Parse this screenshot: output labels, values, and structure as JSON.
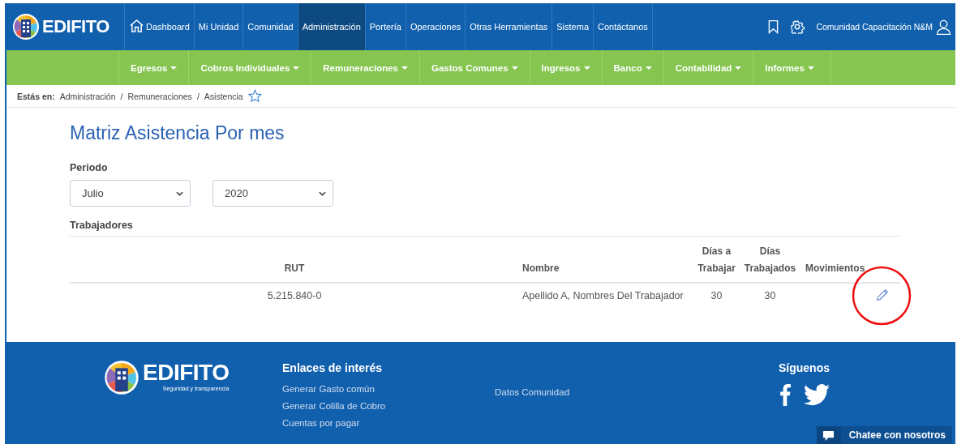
{
  "topnav": {
    "logo": "EDIFITO",
    "items": [
      {
        "label": "Dashboard",
        "kind": "with_icon",
        "selected": false
      },
      {
        "label": "Mi Unidad",
        "kind": "plain",
        "selected": false
      },
      {
        "label": "Comunidad",
        "kind": "plain",
        "selected": false
      },
      {
        "label": "Administración",
        "kind": "plain",
        "selected": true
      },
      {
        "label": "Portería",
        "kind": "plain",
        "selected": false
      },
      {
        "label": "Operaciones",
        "kind": "plain",
        "selected": false
      },
      {
        "label": "Otras Herramientas",
        "kind": "plain",
        "selected": false
      },
      {
        "label": "Sistema",
        "kind": "plain",
        "selected": false
      },
      {
        "label": "Contáctanos",
        "kind": "plain",
        "selected": false
      }
    ],
    "user": "Comunidad Capacitación N&M"
  },
  "subnav": [
    "Egresos",
    "Cobros Individuales",
    "Remuneraciones",
    "Gastos Comunes",
    "Ingresos",
    "Banco",
    "Contabilidad",
    "Informes"
  ],
  "breadcrumb": {
    "prefix": "Estás en:",
    "items": [
      {
        "label": "Administración",
        "separator": "/"
      },
      {
        "label": "Remuneraciones",
        "separator": "/"
      },
      {
        "label": "Asistencia"
      }
    ]
  },
  "page": {
    "title": "Matriz Asistencia Por mes",
    "period_label": "Periodo",
    "selects": [
      {
        "value": "Julio"
      },
      {
        "value": "2020"
      }
    ],
    "section": "Trabajadores",
    "table": {
      "columns": [
        "RUT",
        "Nombre",
        "Días a Trabajar",
        "Días Trabajados",
        "Movimientos"
      ],
      "rows": [
        {
          "rut": "5.215.840-0",
          "nombre": "Apellido A, Nombres Del Trabajador",
          "dias_a_trabajar": "30",
          "dias_trabajados": "30"
        }
      ]
    }
  },
  "footer": {
    "logo": "EDIFITO",
    "tagline": "Seguridad y transparencia",
    "links_title": "Enlaces de interés",
    "links": [
      "Generar Gasto común",
      "Generar Colilla de Cobro",
      "Cuentas por pagar"
    ],
    "links_2": [
      "Datos Comunidad"
    ],
    "follow_title": "Síguenos",
    "chat": "Chatee con nosotros"
  }
}
